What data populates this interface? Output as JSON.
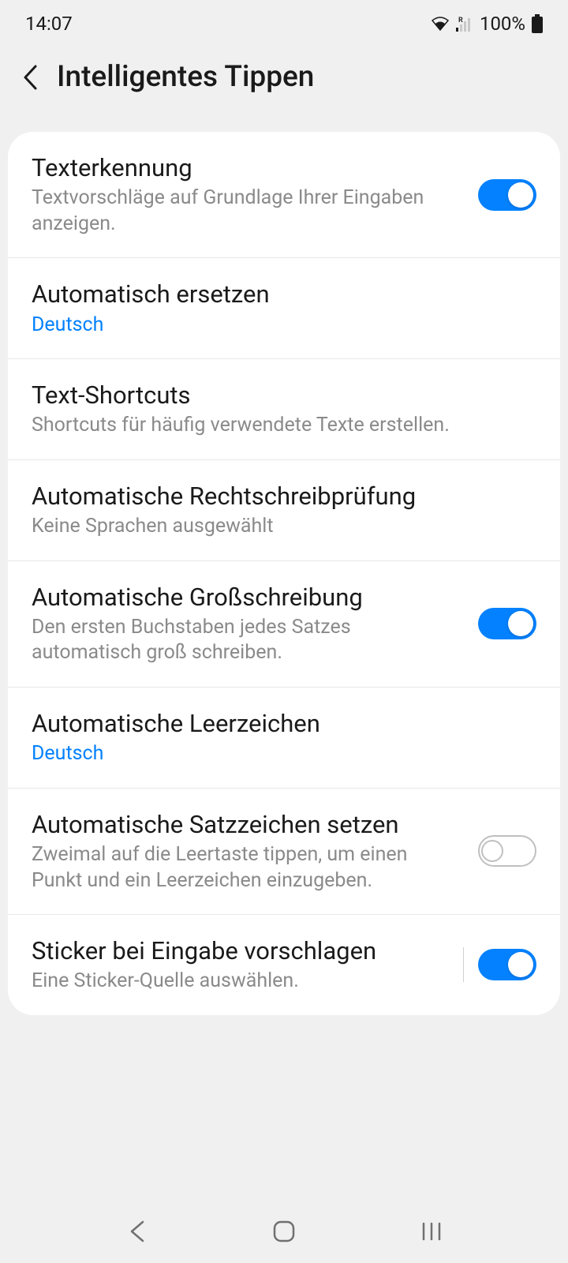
{
  "status": {
    "time": "14:07",
    "battery": "100%"
  },
  "header": {
    "title": "Intelligentes Tippen"
  },
  "settings": {
    "text_recognition": {
      "title": "Texterkennung",
      "subtitle": "Textvorschläge auf Grundlage Ihrer Eingaben anzeigen.",
      "enabled": true
    },
    "auto_replace": {
      "title": "Automatisch ersetzen",
      "language": "Deutsch"
    },
    "text_shortcuts": {
      "title": "Text-Shortcuts",
      "subtitle": "Shortcuts für häufig verwendete Texte erstellen."
    },
    "spell_check": {
      "title": "Automatische Rechtschreibprüfung",
      "subtitle": "Keine Sprachen ausgewählt"
    },
    "auto_capitalize": {
      "title": "Automatische Großschreibung",
      "subtitle": "Den ersten Buchstaben jedes Satzes automatisch groß schreiben.",
      "enabled": true
    },
    "auto_spacing": {
      "title": "Automatische Leerzeichen",
      "language": "Deutsch"
    },
    "auto_punctuate": {
      "title": "Automatische Satzzeichen setzen",
      "subtitle": "Zweimal auf die Leertaste tippen, um einen Punkt und ein Leerzeichen einzugeben.",
      "enabled": false
    },
    "sticker_suggest": {
      "title": "Sticker bei Eingabe vorschlagen",
      "subtitle": "Eine Sticker-Quelle auswählen.",
      "enabled": true
    }
  }
}
